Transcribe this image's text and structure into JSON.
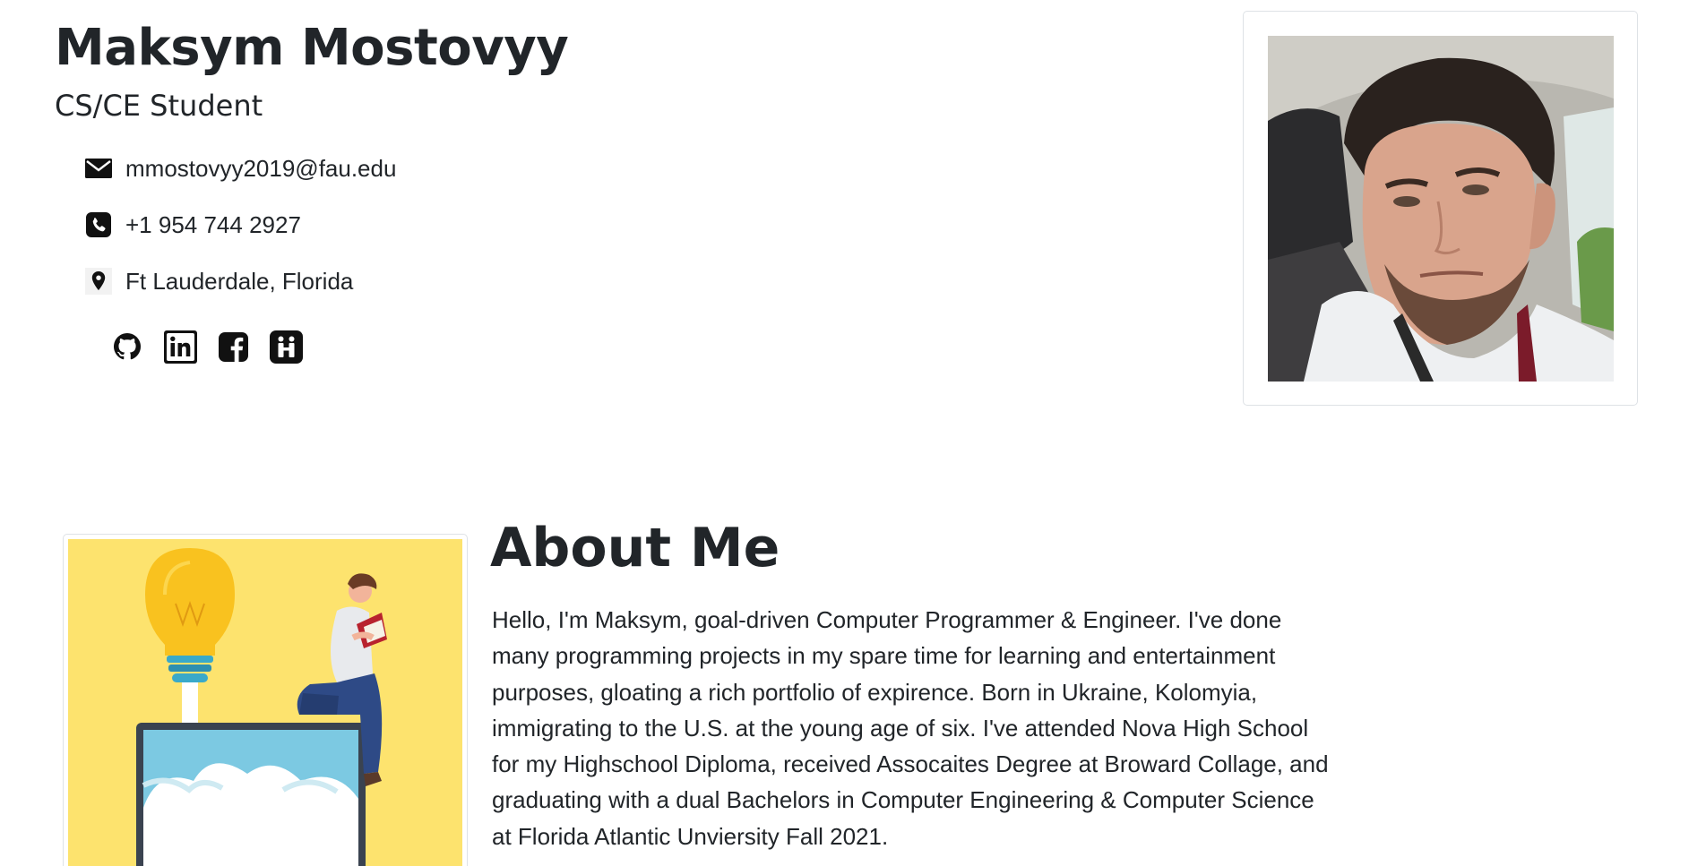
{
  "header": {
    "name": "Maksym Mostovyy",
    "subtitle": "CS/CE Student"
  },
  "contact": {
    "email": {
      "icon": "envelope-icon",
      "text": "mmostovyy2019@fau.edu"
    },
    "phone": {
      "icon": "phone-icon",
      "text": "+1 954 744 2927"
    },
    "location": {
      "icon": "map-pin-icon",
      "text": "Ft Lauderdale, Florida"
    }
  },
  "social": [
    {
      "icon": "github-icon"
    },
    {
      "icon": "linkedin-icon"
    },
    {
      "icon": "facebook-icon"
    },
    {
      "icon": "handshake-icon"
    }
  ],
  "profile_photo": {
    "icon": "profile-photo"
  },
  "about": {
    "title": "About Me",
    "lines": [
      "Hello, I'm Maksym, goal-driven Computer Programmer & Engineer. I've done",
      "many programming projects in my spare time for learning and entertainment",
      "purposes, gloating a rich portfolio of expirence. Born in Ukraine, Kolomyia,",
      "immigrating to the U.S. at the young age of six. I've attended Nova High School",
      "for my Highschool Diploma, received Assocaites Degree at Broward Collage, and",
      "graduating with a dual Bachelors in Computer Engineering & Computer Science",
      "at Florida Atlantic Unviersity Fall 2021."
    ],
    "illustration": "person-reading-on-laptop-with-lightbulb-illustration"
  },
  "colors": {
    "text": "#212529",
    "border": "#dee2e6",
    "illustration_bg": "#fde36e",
    "bulb": "#f9c21f",
    "screen": "#7cc9e2",
    "laptop": "#3a4350"
  }
}
